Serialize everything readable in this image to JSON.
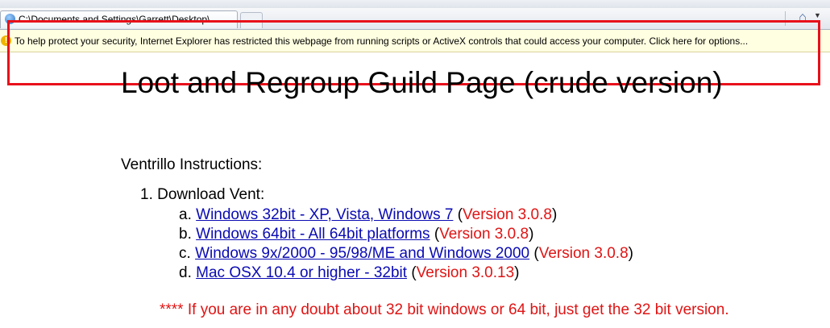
{
  "browser": {
    "tab_title": "C:\\Documents and Settings\\Garrett\\Desktop\\..."
  },
  "infobar": {
    "message": "To help protect your security, Internet Explorer has restricted this webpage from running scripts or ActiveX controls that could access your computer. Click here for options..."
  },
  "page": {
    "title": "Loot and Regroup Guild Page (crude version)",
    "section_heading": "Ventrillo Instructions:",
    "step1": "1. Download Vent:",
    "downloads": [
      {
        "marker": "a.",
        "link": "Windows 32bit - XP, Vista, Windows 7",
        "open": " (",
        "version": "Version 3.0.8",
        "close": ")"
      },
      {
        "marker": "b.",
        "link": "Windows 64bit - All 64bit platforms",
        "open": " (",
        "version": "Version 3.0.8",
        "close": ")"
      },
      {
        "marker": "c.",
        "link": "Windows 9x/2000 - 95/98/ME and Windows 2000",
        "open": " (",
        "version": "Version 3.0.8",
        "close": ")"
      },
      {
        "marker": "d.",
        "link": "Mac OSX 10.4 or higher - 32bit",
        "open": " (",
        "version": "Version 3.0.13",
        "close": ")"
      }
    ],
    "note": "**** If you are in any doubt about 32 bit windows or 64 bit, just get the 32 bit version."
  },
  "colors": {
    "link": "#0a0ab4",
    "version": "#e01414",
    "highlight_box": "#e8101a",
    "infobar_bg": "#ffffe1"
  }
}
